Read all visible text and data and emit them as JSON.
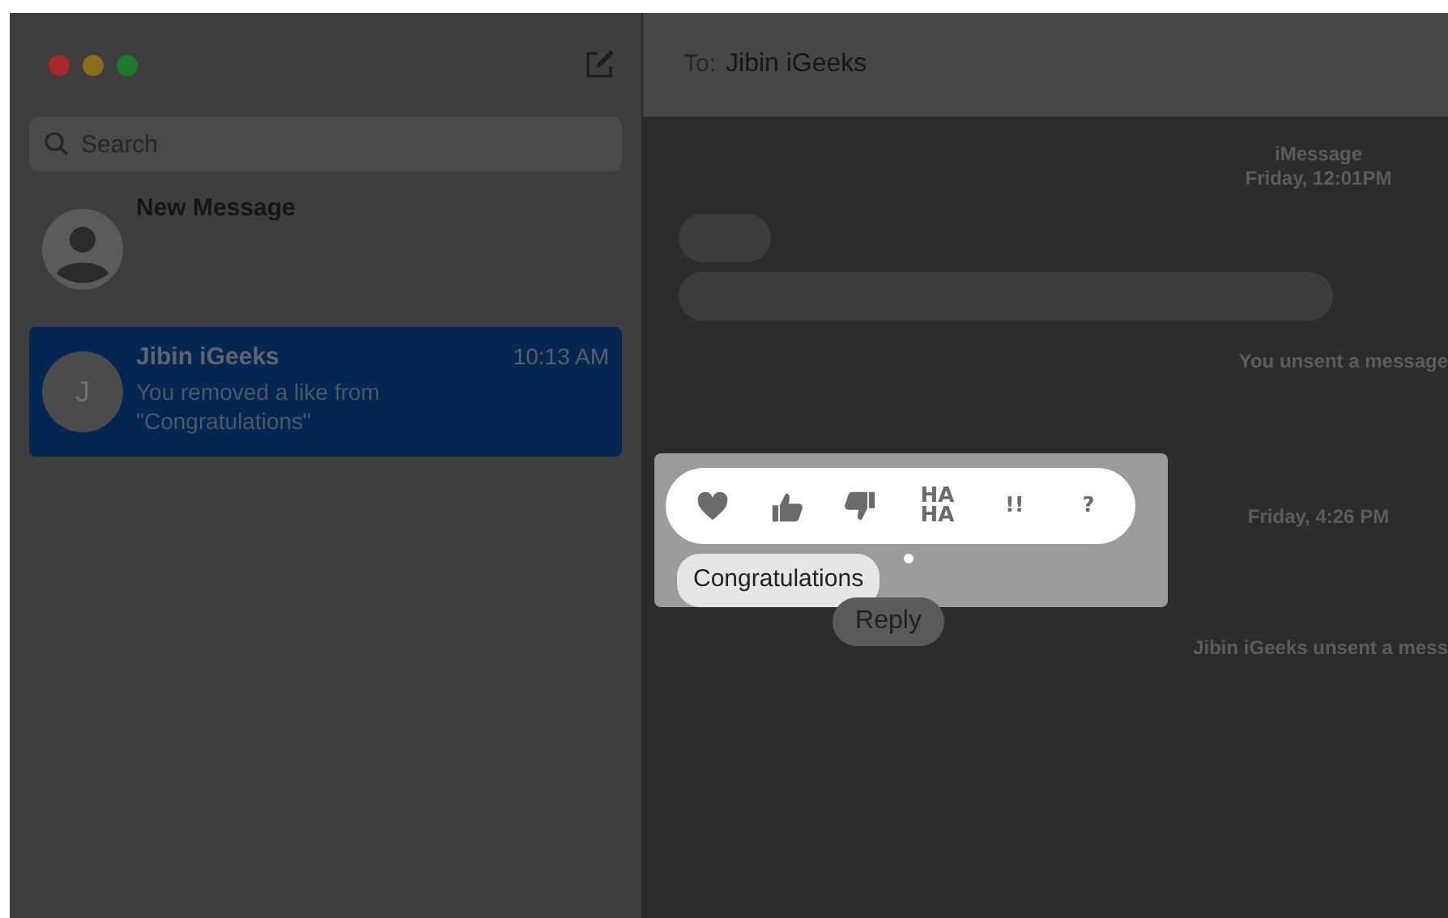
{
  "sidebar": {
    "search": {
      "placeholder": "Search"
    },
    "conversations": [
      {
        "kind": "new",
        "name": "New Message",
        "selected": false
      },
      {
        "kind": "contact",
        "initial": "J",
        "name": "Jibin iGeeks",
        "time": "10:13 AM",
        "preview": "You removed a like from \"Congratulations\"",
        "selected": true
      }
    ]
  },
  "conversation": {
    "to_label": "To:",
    "recipient": "Jibin iGeeks",
    "items": [
      {
        "kind": "timestamp",
        "lines": [
          "iMessage",
          "Friday, 12:01PM"
        ]
      },
      {
        "kind": "short"
      },
      {
        "kind": "long"
      },
      {
        "kind": "notice",
        "text": "You unsent a message"
      },
      {
        "kind": "timestamp",
        "lines": [
          "Friday, 4:26 PM"
        ]
      },
      {
        "kind": "notice",
        "text": "Jibin iGeeks unsent a mess"
      }
    ]
  },
  "tapback": {
    "reactions": [
      {
        "kind": "heart"
      },
      {
        "kind": "thumbs-up"
      },
      {
        "kind": "thumbs-down"
      },
      {
        "kind": "text",
        "text": "HA HA"
      },
      {
        "kind": "text",
        "text": "!!"
      },
      {
        "kind": "text",
        "text": "?"
      }
    ],
    "message": "Congratulations",
    "reply": "Reply"
  }
}
